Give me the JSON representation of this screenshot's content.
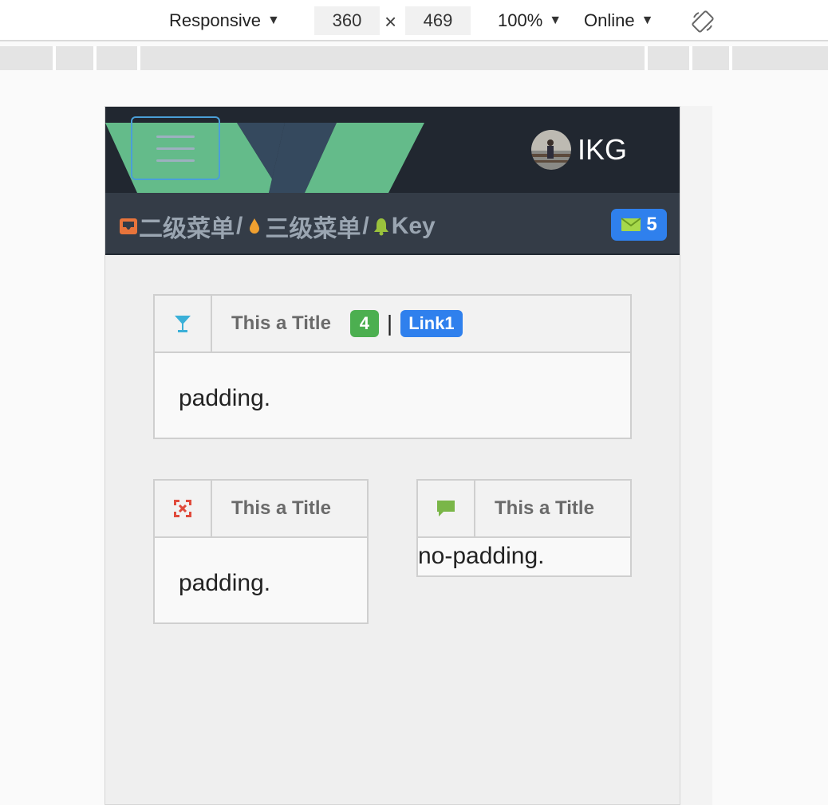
{
  "devtools": {
    "device_label": "Responsive",
    "width_value": "360",
    "height_value": "469",
    "times_symbol": "×",
    "zoom_label": "100%",
    "network_label": "Online",
    "caret": "▼"
  },
  "navbar": {
    "username": "IKG"
  },
  "breadcrumb": {
    "items": [
      "二级菜单",
      "三级菜单",
      "Key"
    ],
    "separator": "/"
  },
  "mail_badge": {
    "count": "5"
  },
  "panels": [
    {
      "title": "This a Title",
      "badge_count": "4",
      "pipe": "|",
      "link_label": "Link1",
      "body": "padding."
    },
    {
      "title": "This a Title",
      "body": "padding."
    },
    {
      "title": "This a Title",
      "body": "no-padding."
    }
  ],
  "colors": {
    "navbar_bg": "#212730",
    "subbar_bg": "#343c47",
    "vue_green": "#64bb8a",
    "vue_dark": "#35495e",
    "accent_blue": "#2f80ed",
    "badge_green": "#4caf50"
  }
}
